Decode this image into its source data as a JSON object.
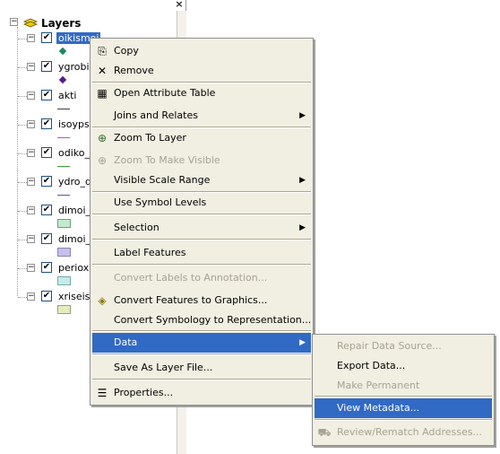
{
  "toc": {
    "close_glyph": "×",
    "root_label": "Layers",
    "layers": [
      {
        "name": "oikismoi",
        "checked": "✔",
        "expander": "−",
        "symbol": "point",
        "color": "#1a8a5a",
        "selected": true
      },
      {
        "name": "ygrobioi",
        "checked": "✔",
        "expander": "−",
        "symbol": "point",
        "color": "#5a1a8a"
      },
      {
        "name": "akti",
        "checked": "✔",
        "expander": "−",
        "symbol": "line",
        "color": "#3d3d3d"
      },
      {
        "name": "isoypses",
        "checked": "✔",
        "expander": "−",
        "symbol": "line",
        "color": "#b05ab0"
      },
      {
        "name": "odiko_diktyo",
        "checked": "✔",
        "expander": "−",
        "symbol": "line",
        "color": "#3aa03a"
      },
      {
        "name": "ydro_diktyo",
        "checked": "✔",
        "expander": "−",
        "symbol": "line",
        "color": "#6b4fa8"
      },
      {
        "name": "dimoi_m",
        "checked": "✔",
        "expander": "−",
        "symbol": "poly",
        "color": "#bfeacb"
      },
      {
        "name": "dimoi_p",
        "checked": "✔",
        "expander": "−",
        "symbol": "poly",
        "color": "#c6c0ec"
      },
      {
        "name": "perioxi",
        "checked": "✔",
        "expander": "−",
        "symbol": "poly",
        "color": "#c2ecec"
      },
      {
        "name": "xriseis_gis",
        "checked": "✔",
        "expander": "−",
        "symbol": "poly",
        "color": "#e6ecc0"
      }
    ]
  },
  "context_menu": {
    "items": [
      {
        "label": "Copy",
        "icon": "copy-icon",
        "glyph": "⎘"
      },
      {
        "label": "Remove",
        "icon": "remove-icon",
        "glyph": "✕"
      },
      {
        "label": "Open Attribute Table",
        "icon": "table-icon",
        "glyph": "▦"
      },
      {
        "label": "Joins and Relates",
        "arrow": "▶"
      },
      {
        "label": "Zoom To Layer",
        "icon": "zoom-layer-icon",
        "glyph": "⊕"
      },
      {
        "label": "Zoom To Make Visible",
        "icon": "zoom-visible-icon",
        "glyph": "⊕",
        "disabled": true
      },
      {
        "label": "Visible Scale Range",
        "arrow": "▶"
      },
      {
        "label": "Use Symbol Levels"
      },
      {
        "label": "Selection",
        "arrow": "▶"
      },
      {
        "label": "Label Features"
      },
      {
        "label": "Convert Labels to Annotation...",
        "disabled": true
      },
      {
        "label": "Convert Features to Graphics...",
        "icon": "convert-graphics-icon",
        "glyph": "◈"
      },
      {
        "label": "Convert Symbology to Representation..."
      },
      {
        "label": "Data",
        "arrow": "▶",
        "highlighted": true
      },
      {
        "label": "Save As Layer File..."
      },
      {
        "label": "Properties...",
        "icon": "properties-icon",
        "glyph": "☰"
      }
    ]
  },
  "data_submenu": {
    "items": [
      {
        "label": "Repair Data Source...",
        "disabled": true
      },
      {
        "label": "Export Data..."
      },
      {
        "label": "Make Permanent",
        "disabled": true
      },
      {
        "label": "View Metadata...",
        "highlighted": true
      },
      {
        "label": "Review/Rematch Addresses...",
        "disabled": true,
        "icon": "geocode-icon",
        "glyph": "⛟"
      }
    ]
  },
  "colors": {
    "highlight": "#316ac5",
    "menu_bg": "#f1efe2",
    "disabled_text": "#a6a294"
  }
}
